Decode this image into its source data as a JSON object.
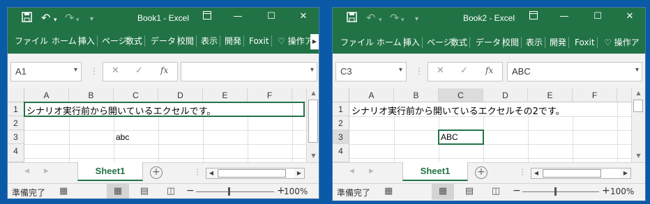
{
  "windows": [
    {
      "title": "Book1 - Excel",
      "ribbon_tabs": [
        "ファイル",
        "ホーム",
        "挿入",
        "ページ",
        "数式",
        "データ",
        "校閲",
        "表示",
        "開発",
        "Foxit",
        "操作ア"
      ],
      "name_box": "A1",
      "formula_value": "",
      "columns": [
        "A",
        "B",
        "C",
        "D",
        "E",
        "F"
      ],
      "rows": [
        "1",
        "2",
        "3",
        "4"
      ],
      "cells": {
        "A1": "シナリオ実行前から開いているエクセルです。",
        "C3": "abc"
      },
      "sheet_tab": "Sheet1",
      "status_ready": "準備完了",
      "zoom": "100%"
    },
    {
      "title": "Book2 - Excel",
      "ribbon_tabs": [
        "ファイル",
        "ホーム",
        "挿入",
        "ページ",
        "数式",
        "データ",
        "校閲",
        "表示",
        "開発",
        "Foxit",
        "操作ア"
      ],
      "name_box": "C3",
      "formula_value": "ABC",
      "columns": [
        "A",
        "B",
        "C",
        "D",
        "E",
        "F"
      ],
      "rows": [
        "1",
        "2",
        "3",
        "4"
      ],
      "cells": {
        "A1": "シナリオ実行前から開いているエクセルその2です。",
        "C3": "ABC"
      },
      "sheet_tab": "Sheet1",
      "status_ready": "準備完了",
      "zoom": "100%"
    }
  ],
  "icons": {
    "save": "floppy-disk-icon",
    "undo": "undo-icon",
    "redo": "redo-icon",
    "ribbon_display": "ribbon-display-icon",
    "minimize": "minimize-icon",
    "maximize": "maximize-icon",
    "close": "close-icon",
    "cancel": "cancel-x-icon",
    "enter": "check-icon",
    "function": "fx-icon",
    "lightbulb": "lightbulb-icon",
    "add_sheet": "plus-circle-icon",
    "macro_record": "macro-record-icon",
    "normal_view": "normal-view-icon",
    "page_layout": "page-layout-icon",
    "page_break": "page-break-icon"
  },
  "colors": {
    "excel_green": "#217346",
    "desktop_blue": "#0a5aa8"
  }
}
